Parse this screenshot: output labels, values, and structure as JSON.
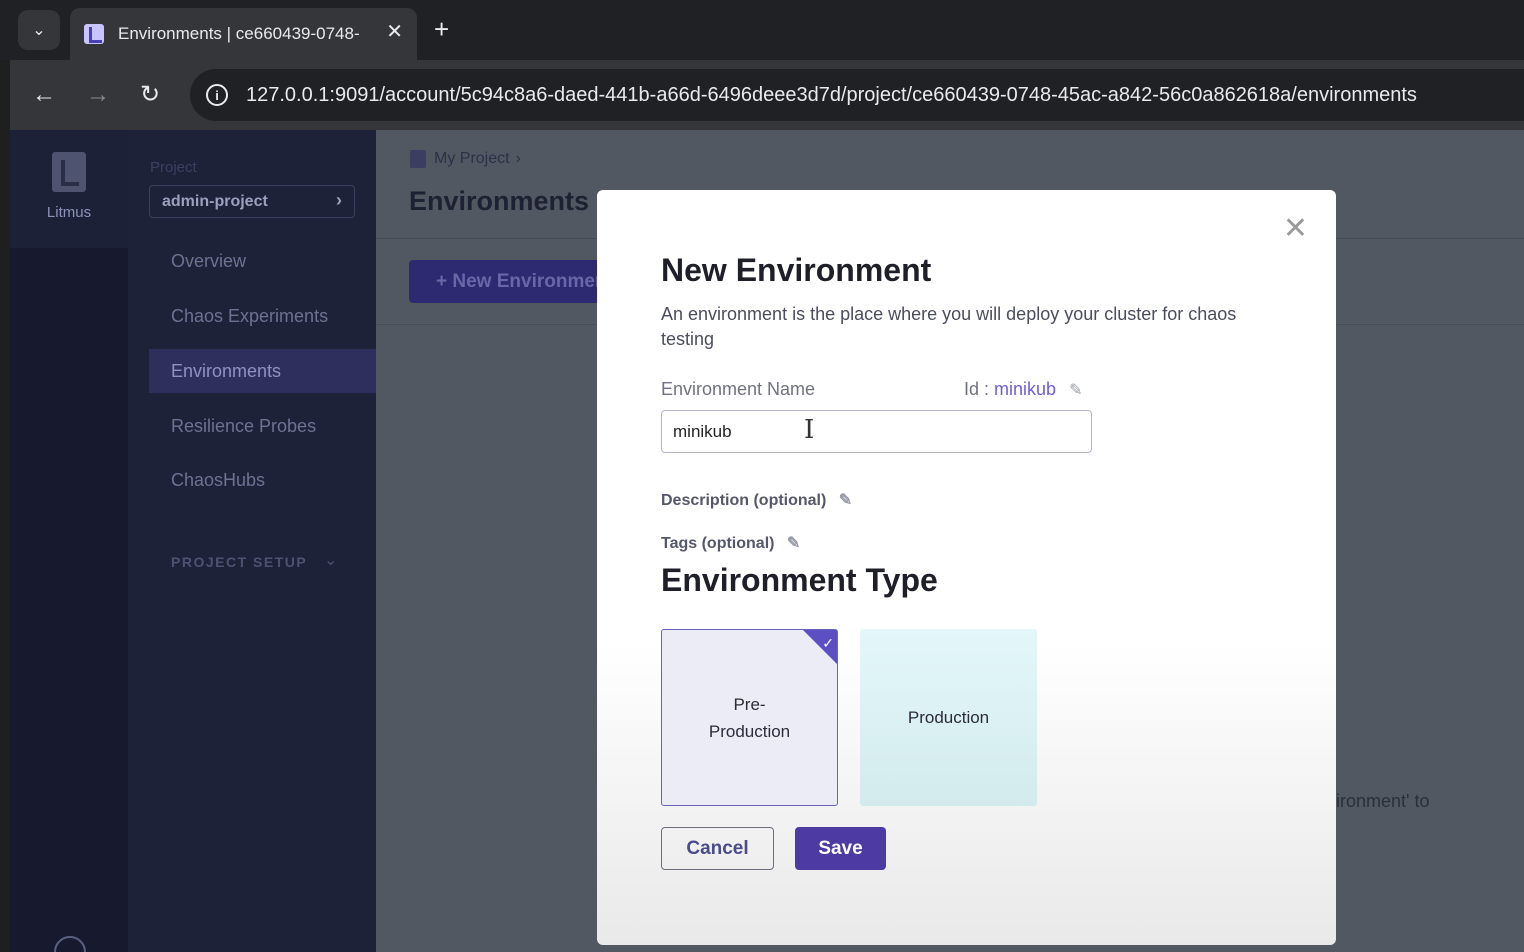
{
  "browser": {
    "tab_title": "Environments | ce660439-0748-",
    "url": "127.0.0.1:9091/account/5c94c8a6-daed-441b-a66d-6496deee3d7d/project/ce660439-0748-45ac-a842-56c0a862618a/environments"
  },
  "rail": {
    "app_name": "Litmus"
  },
  "sidebar": {
    "project_label": "Project",
    "project_value": "admin-project",
    "items": [
      {
        "label": "Overview"
      },
      {
        "label": "Chaos Experiments"
      },
      {
        "label": "Environments",
        "active": true
      },
      {
        "label": "Resilience Probes"
      },
      {
        "label": "ChaosHubs"
      }
    ],
    "setup_label": "PROJECT SETUP"
  },
  "main": {
    "breadcrumb": "My Project",
    "title": "Environments",
    "new_button": "+ New Environment",
    "hint_text": "ironment' to"
  },
  "modal": {
    "title": "New Environment",
    "description": "An environment is the place where you will deploy your cluster for chaos testing",
    "name_label": "Environment Name",
    "id_prefix": "Id :",
    "id_value": "minikub",
    "name_value": "minikub",
    "description_label": "Description (optional)",
    "tags_label": "Tags (optional)",
    "type_title": "Environment Type",
    "types": [
      {
        "label": "Pre-Production",
        "selected": true
      },
      {
        "label": "Production",
        "selected": false
      }
    ],
    "cancel_label": "Cancel",
    "save_label": "Save"
  }
}
